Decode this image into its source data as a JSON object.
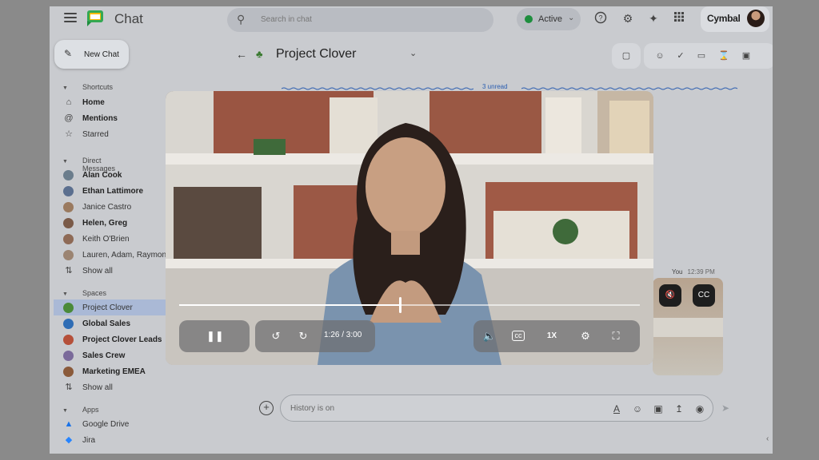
{
  "app": {
    "title": "Chat",
    "brand": "Cymbal"
  },
  "search": {
    "placeholder": "Search in chat"
  },
  "status": {
    "label": "Active",
    "color": "#1e8e3e"
  },
  "topbar_icons": [
    "help-icon",
    "settings-icon",
    "gemini-icon",
    "apps-grid-icon"
  ],
  "sidebar": {
    "new_chat": "New Chat",
    "shortcuts_heading": "Shortcuts",
    "shortcuts": [
      {
        "label": "Home",
        "icon": "home-icon",
        "bold": true
      },
      {
        "label": "Mentions",
        "icon": "at-icon",
        "bold": true
      },
      {
        "label": "Starred",
        "icon": "star-icon",
        "bold": false
      }
    ],
    "dm_heading": "Direct Messages",
    "dms": [
      {
        "label": "Alan Cook",
        "bold": true,
        "color": "#6b7d8c"
      },
      {
        "label": "Ethan Lattimore",
        "bold": true,
        "color": "#5b6f8f"
      },
      {
        "label": "Janice Castro",
        "bold": false,
        "color": "#9a7a5f"
      },
      {
        "label": "Helen, Greg",
        "bold": true,
        "color": "#7a5a48"
      },
      {
        "label": "Keith O'Brien",
        "bold": false,
        "color": "#8e6a56"
      },
      {
        "label": "Lauren, Adam, Raymond",
        "bold": false,
        "color": "#9b8472"
      }
    ],
    "dms_show_all": "Show all",
    "spaces_heading": "Spaces",
    "spaces": [
      {
        "label": "Project Clover",
        "bold": false,
        "selected": true,
        "color": "#4a8a3a"
      },
      {
        "label": "Global Sales",
        "bold": true,
        "selected": false,
        "color": "#2f6db5"
      },
      {
        "label": "Project Clover Leads",
        "bold": true,
        "selected": false,
        "color": "#b5503a"
      },
      {
        "label": "Sales Crew",
        "bold": true,
        "selected": false,
        "color": "#7a6a9a"
      },
      {
        "label": "Marketing EMEA",
        "bold": true,
        "selected": false,
        "color": "#8a5a3a"
      }
    ],
    "spaces_show_all": "Show all",
    "apps_heading": "Apps",
    "apps": [
      {
        "label": "Google Drive",
        "icon": "google-drive-icon"
      },
      {
        "label": "Jira",
        "icon": "jira-icon"
      }
    ]
  },
  "space": {
    "title": "Project Clover"
  },
  "header_tools": [
    "meet-icon",
    "add-people-icon",
    "tasks-icon",
    "files-icon",
    "timer-icon",
    "calendar-icon"
  ],
  "unread": {
    "label": "3 unread"
  },
  "message": {
    "author": "You",
    "time": "12:39 PM"
  },
  "composer": {
    "placeholder": "History is on",
    "icons": [
      "format-text-icon",
      "emoji-icon",
      "gif-icon",
      "upload-icon",
      "record-icon"
    ]
  },
  "video": {
    "time": "1:26 / 3:00",
    "progress": 0.478,
    "speed": "1X"
  }
}
